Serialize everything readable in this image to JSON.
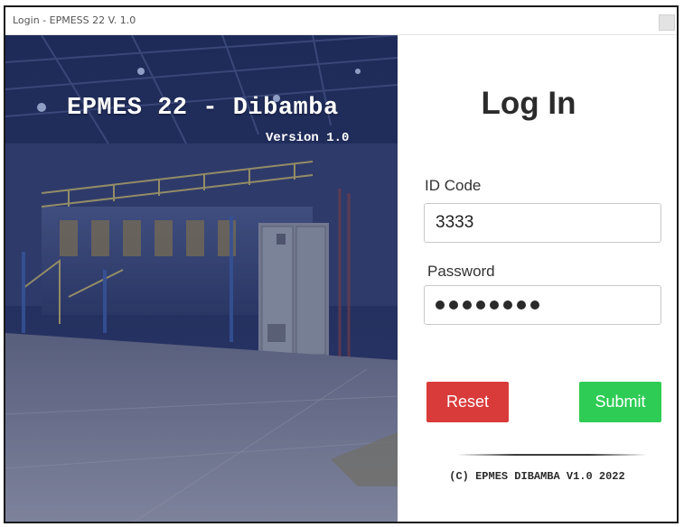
{
  "window": {
    "title": "Login - EPMESS 22 V. 1.0"
  },
  "hero": {
    "app_name": "EPMES 22 - Dibamba",
    "version": "Version 1.0",
    "image_subject": "industrial engine hall background"
  },
  "login": {
    "heading": "Log In",
    "id_label": "ID Code",
    "id_value": "3333",
    "password_label": "Password",
    "password_mask_count": 8,
    "reset_label": "Reset",
    "submit_label": "Submit"
  },
  "footer": {
    "copyright": "(C) EPMES DIBAMBA V1.0 2022"
  },
  "colors": {
    "reset_button": "#d93a3a",
    "submit_button": "#2ecc55",
    "hero_overlay": "#2b335a"
  }
}
